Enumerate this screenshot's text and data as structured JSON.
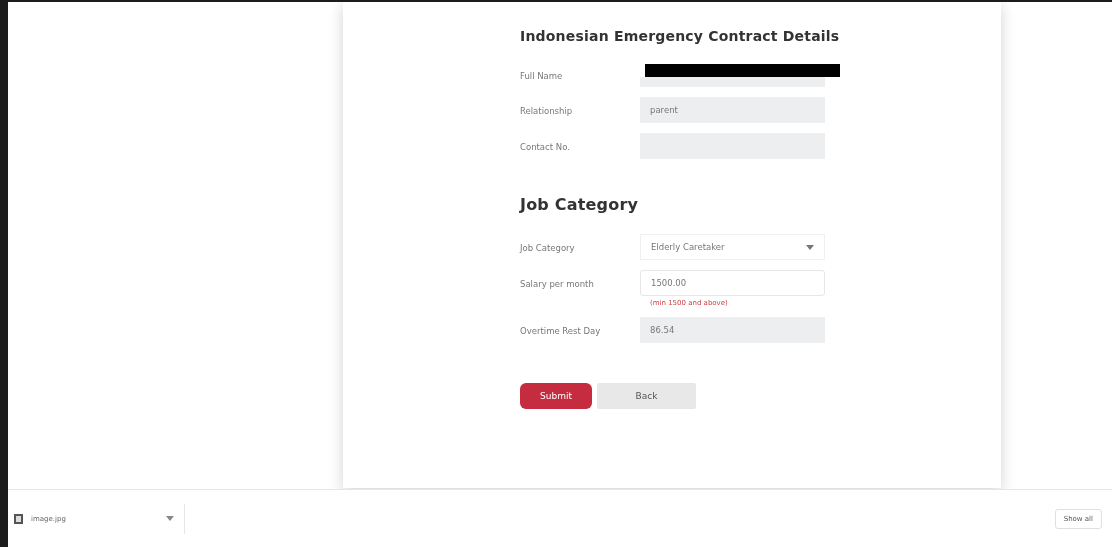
{
  "sections": [
    {
      "title": "Indonesian Emergency Contract Details",
      "fields": [
        {
          "kind": "readonly",
          "label": "Full Name",
          "redacted": true
        },
        {
          "kind": "readonly",
          "label": "Relationship",
          "value": "parent"
        },
        {
          "kind": "readonly",
          "label": "Contact No."
        }
      ]
    },
    {
      "title": "Job Category",
      "fields": [
        {
          "kind": "select",
          "label": "Job Category",
          "value": "Elderly Caretaker"
        },
        {
          "kind": "input",
          "label": "Salary per month",
          "value": "1500.00",
          "hint": "(min 1500 and above)"
        },
        {
          "kind": "readonly",
          "label": "Overtime Rest Day",
          "value": "86.54"
        }
      ]
    }
  ],
  "buttons": [
    {
      "label": "Submit",
      "kind": "primary"
    },
    {
      "label": "Back",
      "kind": "secondary"
    }
  ],
  "download_bar": {
    "file": "image.jpg",
    "show_all": "Show all"
  }
}
